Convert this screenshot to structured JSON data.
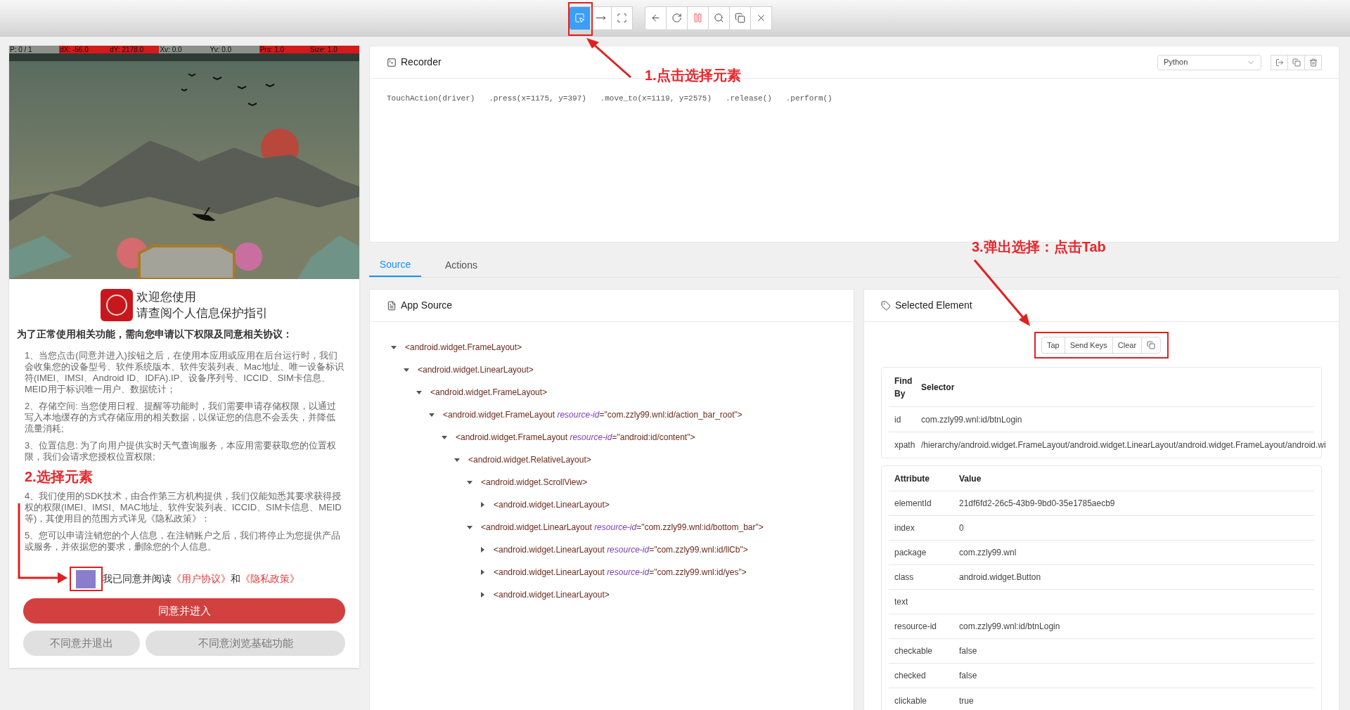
{
  "toolbar": {
    "groups": [
      [
        {
          "kind": "select",
          "selected": true
        },
        {
          "kind": "swipe",
          "selected": false
        },
        {
          "kind": "tap",
          "selected": false
        }
      ],
      [
        {
          "kind": "back",
          "selected": false
        },
        {
          "kind": "refresh",
          "selected": false
        },
        {
          "kind": "pause",
          "selected": false
        },
        {
          "kind": "search",
          "selected": false
        },
        {
          "kind": "copy",
          "selected": false
        },
        {
          "kind": "quit",
          "selected": false
        }
      ]
    ]
  },
  "device": {
    "pointer_info": [
      {
        "text": "P: 0 / 1",
        "highlighted": false
      },
      {
        "text": "dX: -56.0",
        "highlighted": true
      },
      {
        "text": "dY: 2178.0",
        "highlighted": true
      },
      {
        "text": "Xv: 0.0",
        "highlighted": false
      },
      {
        "text": "Yv: 0.0",
        "highlighted": false
      },
      {
        "text": "Prs: 1.0",
        "highlighted": true
      },
      {
        "text": "Size: 1.0",
        "highlighted": true
      }
    ],
    "dialog": {
      "welcome": "欢迎您使用",
      "subtitle": "请查阅个人信息保护指引",
      "heading": "为了正常使用相关功能，需向您申请以下权限及同意相关协议：",
      "paragraphs": [
        "1、当您点击(同意并进入)按钮之后，在使用本应用或应用在后台运行时，我们会收集您的设备型号、软件系统版本、软件安装列表、Mac地址、唯一设备标识符(IMEI、IMSI、Android ID、IDFA).IP、设备序列号、ICCID、SIM卡信息、MEID用于标识唯一用户、数据统计；",
        "2、存储空间: 当您使用日程、提醒等功能时，我们需要申请存储权限，以通过写入本地缓存的方式存储应用的相关数据，以保证您的信息不会丢失，并降低流量消耗;",
        "3、位置信息: 为了向用户提供实时天气查询服务，本应用需要获取您的位置权限，我们会请求您授权位置权限;",
        "4、我们使用的SDK技术，由合作第三方机构提供，我们仅能知悉其要求获得授权的权限(IMEI、IMSI、MAC地址、软件安装列表、ICCID、SIM卡信息、MEID等)，其使用目的范围方式详见《隐私政策》：",
        "5、您可以申请注销您的个人信息，在注销账户之后，我们将停止为您提供产品或服务，并依据您的要求，删除您的个人信息。"
      ],
      "consent": {
        "text": "我已同意并阅读",
        "link_1": "《用户协议》",
        "joiner": "和",
        "link_2": "《隐私政策》",
        "highlighted": true
      },
      "accept_button": "同意并进入",
      "decline_buttons": [
        "不同意并退出",
        "不同意浏览基础功能"
      ]
    }
  },
  "recorder": {
    "title": "Recorder",
    "language": "Python",
    "code": "TouchAction(driver)   .press(x=1175, y=397)   .move_to(x=1119, y=2575)   .release()   .perform()"
  },
  "tabs": [
    {
      "label": "Source",
      "selected": true
    },
    {
      "label": "Actions",
      "selected": false
    }
  ],
  "app_source": {
    "title": "App Source",
    "tree": [
      {
        "label": "<android.widget.FrameLayout>",
        "expanded": true,
        "children": [
          {
            "label": "<android.widget.LinearLayout>",
            "expanded": true,
            "children": [
              {
                "label": "<android.widget.FrameLayout>",
                "expanded": true,
                "children": [
                  {
                    "label": "<android.widget.FrameLayout *resource-id*=\"com.zzly99.wnl:id/action_bar_root\">",
                    "expanded": true,
                    "children": [
                      {
                        "label": "<android.widget.FrameLayout *resource-id*=\"android:id/content\">",
                        "expanded": true,
                        "children": [
                          {
                            "label": "<android.widget.RelativeLayout>",
                            "expanded": true,
                            "children": [
                              {
                                "label": "<android.widget.ScrollView>",
                                "expanded": true,
                                "children": [
                                  {
                                    "label": "<android.widget.LinearLayout>",
                                    "expanded": false
                                  }
                                ]
                              },
                              {
                                "label": "<android.widget.LinearLayout *resource-id*=\"com.zzly99.wnl:id/bottom_bar\">",
                                "expanded": true,
                                "children": [
                                  {
                                    "label": "<android.widget.LinearLayout *resource-id*=\"com.zzly99.wnl:id/llCb\">",
                                    "expanded": false
                                  },
                                  {
                                    "label": "<android.widget.LinearLayout *resource-id*=\"com.zzly99.wnl:id/yes\">",
                                    "expanded": false
                                  },
                                  {
                                    "label": "<android.widget.LinearLayout>",
                                    "expanded": false
                                  }
                                ]
                              }
                            ]
                          }
                        ]
                      }
                    ]
                  }
                ]
              }
            ]
          }
        ]
      }
    ]
  },
  "selected_element": {
    "title": "Selected Element",
    "actions": [
      "Tap",
      "Send Keys",
      "Clear"
    ],
    "selectors": {
      "columns": [
        "Find By",
        "Selector"
      ],
      "rows": [
        [
          "id",
          "com.zzly99.wnl:id/btnLogin"
        ],
        [
          "xpath",
          "/hierarchy/android.widget.FrameLayout/android.widget.LinearLayout/android.widget.FrameLayout/android.wi"
        ]
      ]
    },
    "attributes": {
      "columns": [
        "Attribute",
        "Value"
      ],
      "rows": [
        [
          "elementId",
          "21df6fd2-26c5-43b9-9bd0-35e1785aecb9"
        ],
        [
          "index",
          "0"
        ],
        [
          "package",
          "com.zzly99.wnl"
        ],
        [
          "class",
          "android.widget.Button"
        ],
        [
          "text",
          ""
        ],
        [
          "resource-id",
          "com.zzly99.wnl:id/btnLogin"
        ],
        [
          "checkable",
          "false"
        ],
        [
          "checked",
          "false"
        ],
        [
          "clickable",
          "true"
        ]
      ]
    }
  },
  "annotations": [
    "1.点击选择元素",
    "2.选择元素",
    "3.弹出选择：点击Tab"
  ]
}
